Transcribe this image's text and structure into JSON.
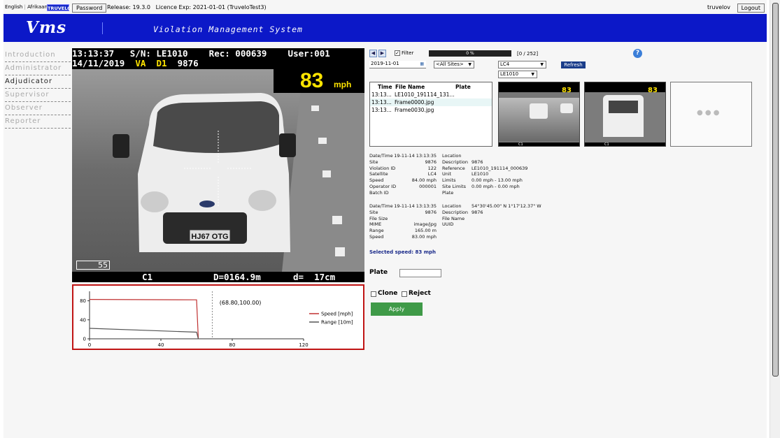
{
  "topbar": {
    "lang_en": "English",
    "lang_af": "Afrikaans",
    "brand": "TRUVELO",
    "password": "Password",
    "release": "Release: 19.3.0",
    "licence": "Licence Exp: 2021-01-01 (TruveloTest3)",
    "user": "truvelov",
    "logout": "Logout"
  },
  "header": {
    "logo": "Vms",
    "title": "Violation Management System"
  },
  "nav": [
    {
      "label": "Introduction",
      "active": false
    },
    {
      "label": "Administrator",
      "active": false
    },
    {
      "label": "Adjudicator",
      "active": true
    },
    {
      "label": "Supervisor",
      "active": false
    },
    {
      "label": "Observer",
      "active": false
    },
    {
      "label": "Reporter",
      "active": false
    }
  ],
  "photo": {
    "line1": "13:13:37   S/N: LE1010    Rec: 000639    User:001",
    "line2_date": "14/11/2019",
    "line2_va": "VA",
    "line2_d1": "D1",
    "line2_code": "9876",
    "speed": "83",
    "speed_unit": "mph",
    "plate": "HJ67 OTG",
    "corner": "55",
    "footer_c1": "C1",
    "footer_d": "D=0164.9m",
    "footer_d2": "d=  17cm"
  },
  "controls": {
    "filter": "Filter",
    "filter_checked": true,
    "progress": "0 %",
    "progress_value": 0,
    "count": "[0 / 252]",
    "date": "2019-11-01",
    "sites": "<All Sites>",
    "lc": "LC4",
    "device": "LE1010",
    "refresh": "Refresh",
    "help_icon": "help-icon"
  },
  "files": {
    "headers": [
      "Time",
      "File Name",
      "Plate"
    ],
    "rows": [
      {
        "time": "13:13...",
        "name": "LE1010_191114_131...",
        "plate": ""
      },
      {
        "time": "13:13...",
        "name": "Frame0000.jpg",
        "plate": ""
      },
      {
        "time": "13:13...",
        "name": "Frame0030.jpg",
        "plate": ""
      }
    ]
  },
  "thumbs": [
    {
      "speed": "83",
      "label": "C1"
    },
    {
      "speed": "83",
      "label": "C1"
    },
    {
      "dots": "● ● ●"
    }
  ],
  "info1": {
    "left": [
      [
        "Date/Time",
        "19-11-14 13:13:35"
      ],
      [
        "Site",
        "9876"
      ],
      [
        "Violation ID",
        "122"
      ],
      [
        "Satellite",
        "LC4"
      ],
      [
        "Speed",
        "84.00 mph"
      ],
      [
        "Operator ID",
        "000001"
      ],
      [
        "Batch ID",
        ""
      ]
    ],
    "right": [
      [
        "Location",
        ""
      ],
      [
        "Description",
        "9876"
      ],
      [
        "Reference",
        "LE1010_191114_000639"
      ],
      [
        "Unit",
        "LE1010"
      ],
      [
        "Limits",
        "0.00 mph - 13.00 mph"
      ],
      [
        "Site Limits",
        "0.00 mph - 0.00 mph"
      ],
      [
        "Plate",
        ""
      ]
    ]
  },
  "info2": {
    "left": [
      [
        "Date/Time",
        "19-11-14 13:13:35"
      ],
      [
        "Site",
        "9876"
      ],
      [
        "File Size",
        ""
      ],
      [
        "MIME",
        "image/jpg"
      ],
      [
        "Range",
        "165.00 m"
      ],
      [
        "Speed",
        "83.00 mph"
      ]
    ],
    "right": [
      [
        "Location",
        "54°30'45.00\" N 1°17'12.37\" W"
      ],
      [
        "Description",
        "9876"
      ],
      [
        "File Name",
        ""
      ],
      [
        "UUID",
        ""
      ]
    ]
  },
  "selected_speed": "Selected speed: 83 mph",
  "plate_label": "Plate",
  "plate_value": "",
  "clone": "Clone",
  "reject": "Reject",
  "apply": "Apply",
  "chart_data": {
    "type": "line",
    "xlim": [
      0,
      120
    ],
    "ylim": [
      0,
      100
    ],
    "x_ticks": [
      0,
      40,
      80,
      120
    ],
    "y_ticks": [
      0,
      40,
      80
    ],
    "cursor_label": "(68.80,100.00)",
    "cursor_x": 68.8,
    "legend_position": "right",
    "series": [
      {
        "name": "Speed [mph]",
        "color": "#c03030",
        "points": [
          [
            0,
            83
          ],
          [
            60,
            82
          ],
          [
            61,
            0
          ]
        ]
      },
      {
        "name": "Range [10m]",
        "color": "#555555",
        "points": [
          [
            0,
            22
          ],
          [
            60,
            14
          ],
          [
            61,
            0
          ]
        ]
      }
    ]
  }
}
